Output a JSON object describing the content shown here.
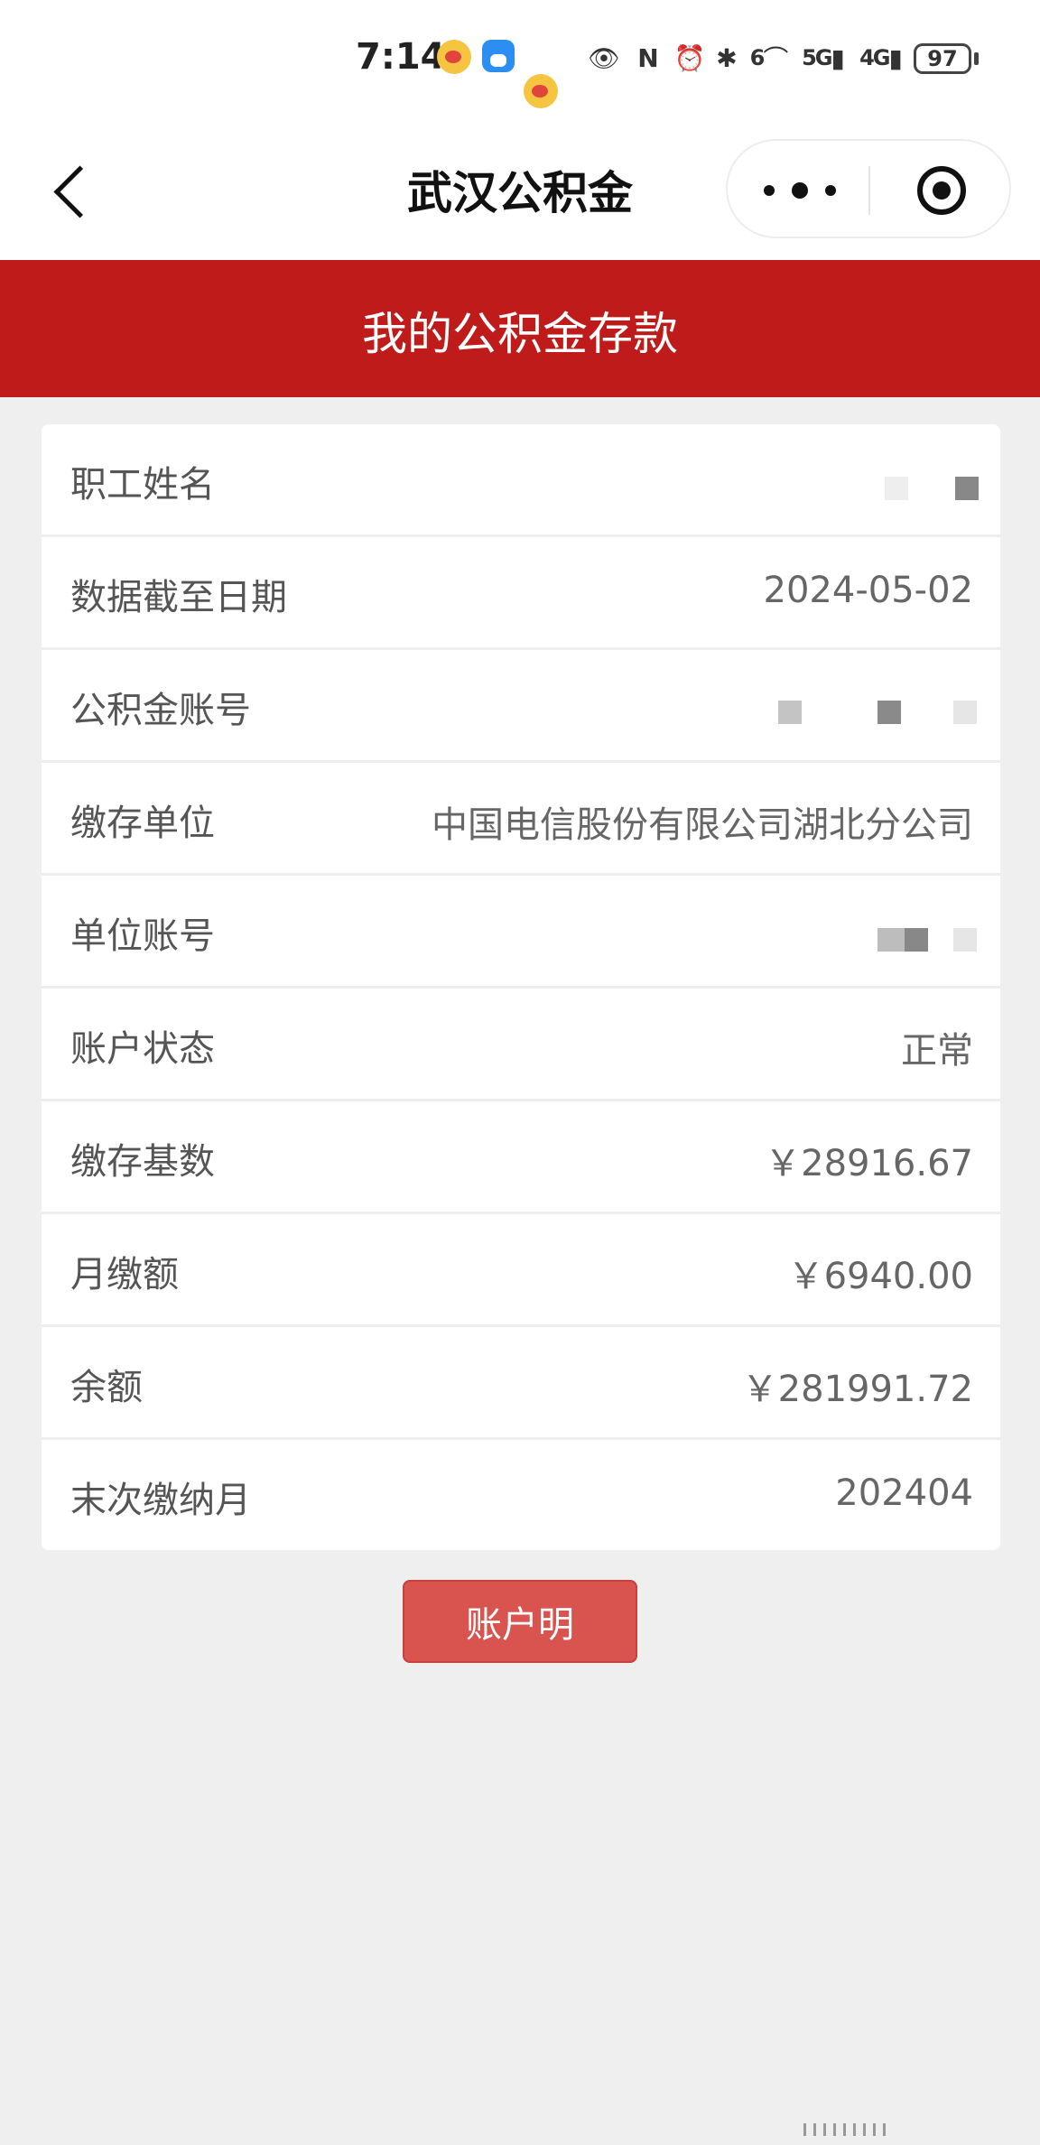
{
  "status_bar": {
    "time": "7:14",
    "signal_1_label": "5G",
    "signal_2_label": "4G",
    "wifi_label": "6",
    "battery": "97",
    "icons": [
      "weibo-icon",
      "chat-icon",
      "weibo-icon",
      "eye-icon",
      "nfc-icon",
      "alarm-icon",
      "bluetooth-icon",
      "wifi-icon",
      "signal-icon",
      "signal-icon",
      "battery-icon"
    ]
  },
  "nav": {
    "title": "武汉公积金"
  },
  "header": {
    "title": "我的公积金存款"
  },
  "rows": [
    {
      "label": "职工姓名",
      "value": ""
    },
    {
      "label": "数据截至日期",
      "value": "2024-05-02"
    },
    {
      "label": "公积金账号",
      "value": ""
    },
    {
      "label": "缴存单位",
      "value": "中国电信股份有限公司湖北分公司"
    },
    {
      "label": "单位账号",
      "value": ""
    },
    {
      "label": "账户状态",
      "value": "正常"
    },
    {
      "label": "缴存基数",
      "value": "￥28916.67"
    },
    {
      "label": "月缴额",
      "value": "￥6940.00"
    },
    {
      "label": "余额",
      "value": "￥281991.72"
    },
    {
      "label": "末次缴纳月",
      "value": "202404"
    }
  ],
  "button": {
    "label": "账户明"
  },
  "colors": {
    "header_red": "#bf1b1b",
    "button_red": "#d9534f",
    "background": "#efefef"
  }
}
